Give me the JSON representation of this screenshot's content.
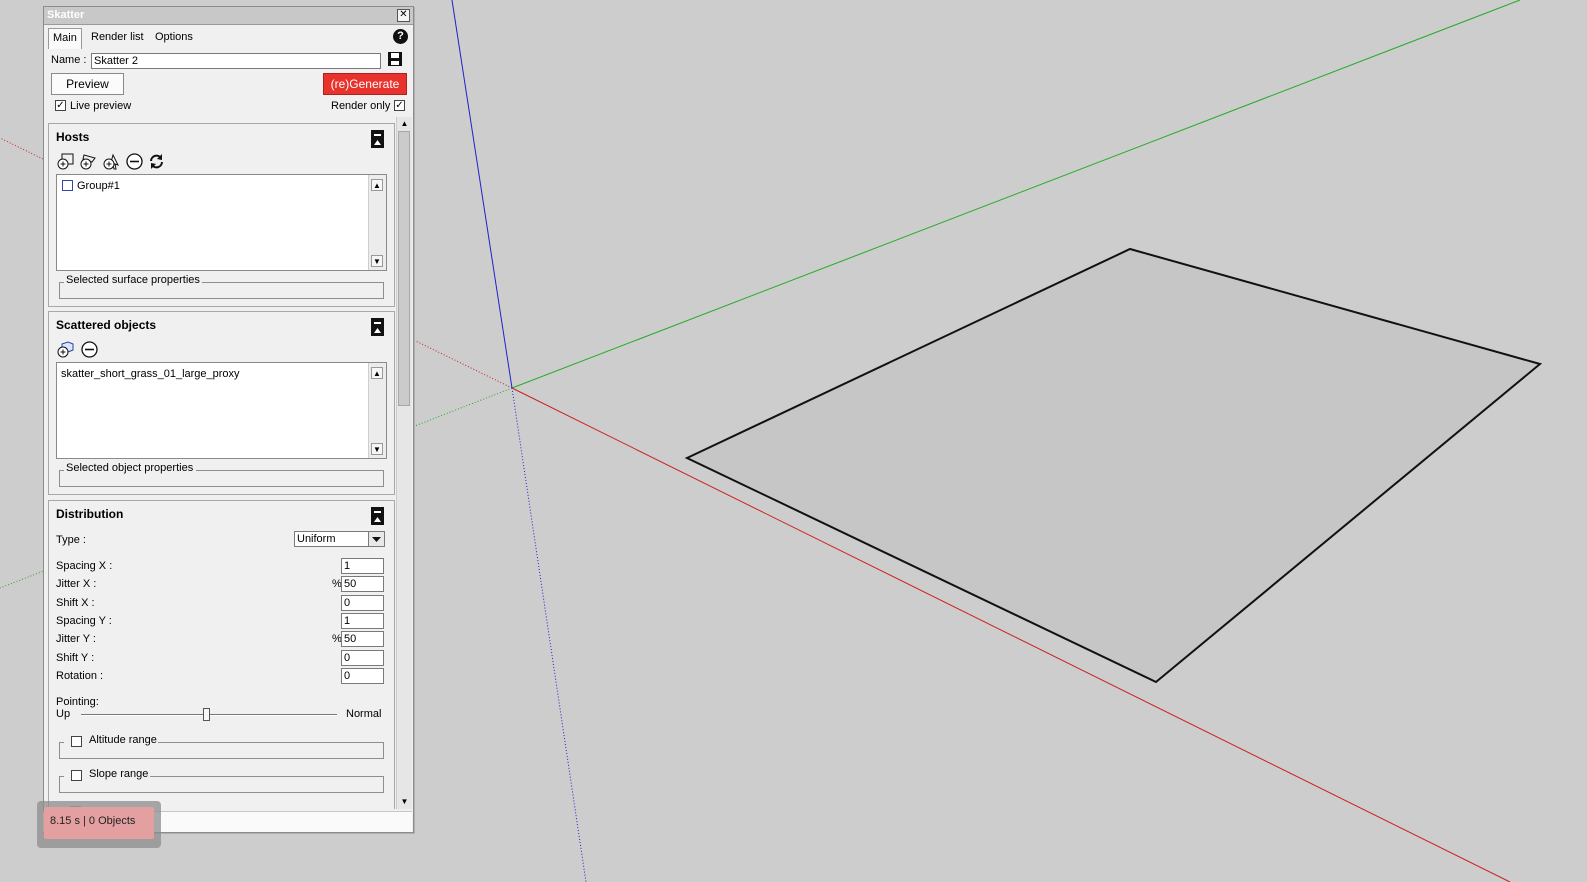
{
  "window": {
    "title": "Skatter",
    "close": "✕"
  },
  "tabs": [
    {
      "label": "Main"
    },
    {
      "label": "Render list"
    },
    {
      "label": "Options"
    }
  ],
  "help": "?",
  "name": {
    "label": "Name :",
    "value": "Skatter 2"
  },
  "buttons": {
    "preview": "Preview",
    "generate": "(re)Generate"
  },
  "live_preview": {
    "label": "Live preview",
    "checked": true
  },
  "render_only": {
    "label": "Render only",
    "checked": true
  },
  "hosts": {
    "title": "Hosts",
    "items": [
      {
        "label": "Group#1"
      }
    ],
    "selected_props": "Selected surface properties"
  },
  "scattered": {
    "title": "Scattered objects",
    "items": [
      {
        "label": "skatter_short_grass_01_large_proxy"
      }
    ],
    "selected_props": "Selected object properties"
  },
  "distribution": {
    "title": "Distribution",
    "type_label": "Type :",
    "type_value": "Uniform",
    "fields": [
      {
        "label": "Spacing X :",
        "prefix": "",
        "value": "1"
      },
      {
        "label": "Jitter X :",
        "prefix": "%",
        "value": "50"
      },
      {
        "label": "Shift X :",
        "prefix": "",
        "value": "0"
      },
      {
        "label": "Spacing Y :",
        "prefix": "",
        "value": "1"
      },
      {
        "label": "Jitter Y :",
        "prefix": "%",
        "value": "50"
      },
      {
        "label": "Shift Y :",
        "prefix": "",
        "value": "0"
      },
      {
        "label": "Rotation :",
        "prefix": "",
        "value": "0"
      }
    ],
    "pointing_label": "Pointing:",
    "pointing_left": "Up",
    "pointing_right": "Normal",
    "pointing_value": 0.49,
    "altitude": "Altitude range",
    "slope": "Slope range"
  },
  "status": "8.15 s | 0 Objects",
  "colors": {
    "x_axis": "#cc2020",
    "y_axis": "#22aa22",
    "z_axis": "#2020cc",
    "generate": "#e8322c",
    "plane": "#c6c6c6"
  }
}
